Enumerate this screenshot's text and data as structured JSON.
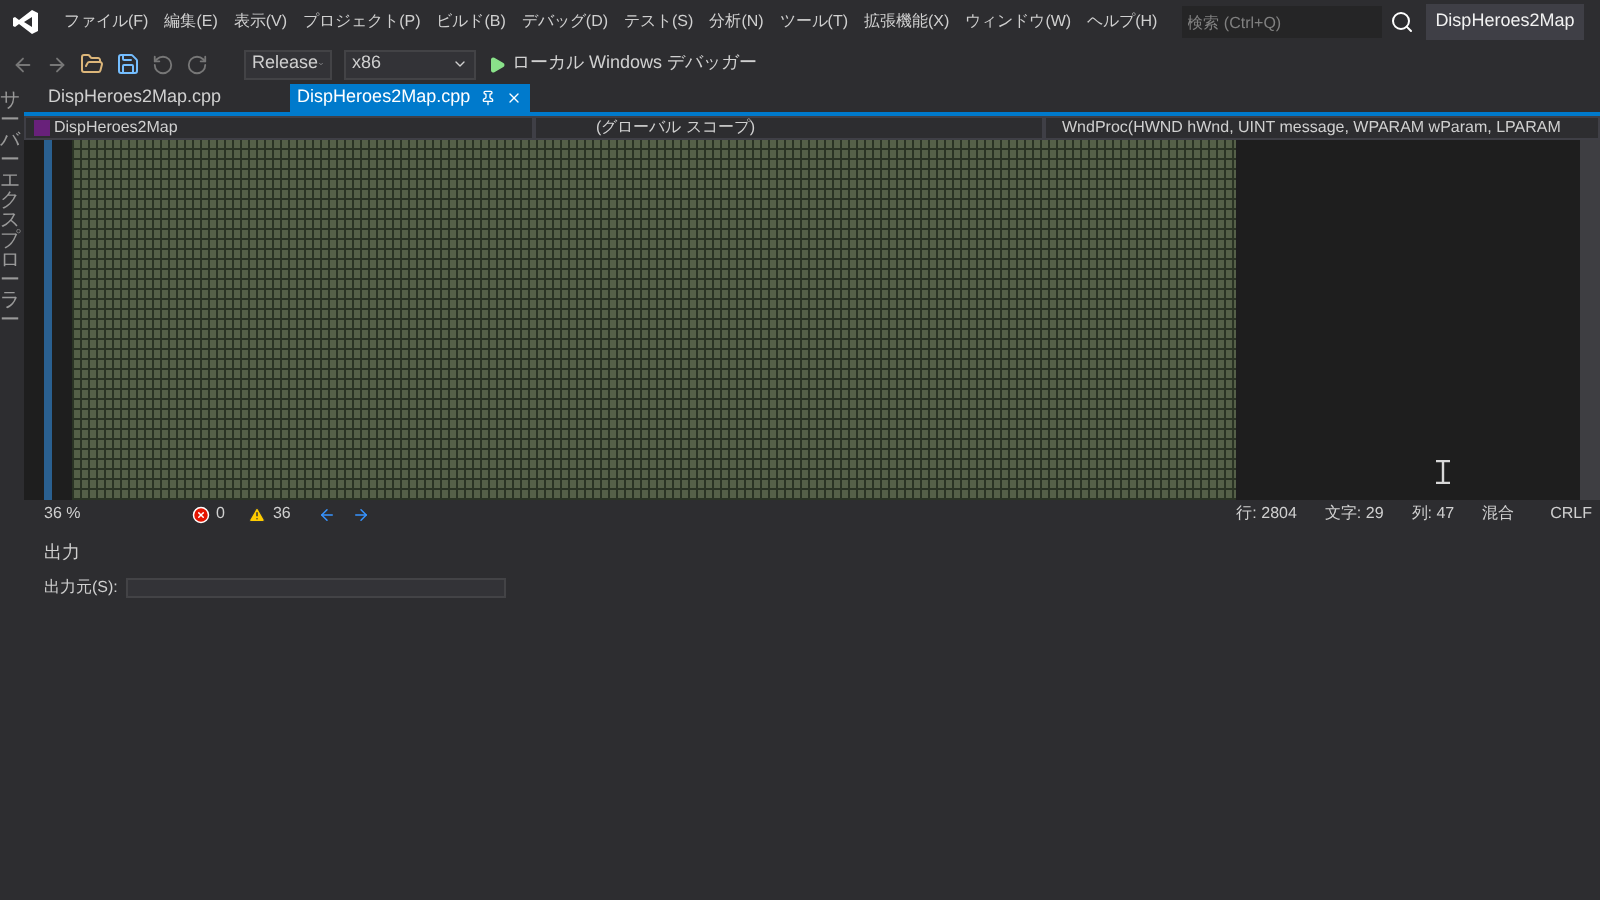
{
  "menu": [
    "ファイル(F)",
    "編集(E)",
    "表示(V)",
    "プロジェクト(P)",
    "ビルド(B)",
    "デバッグ(D)",
    "テスト(S)",
    "分析(N)",
    "ツール(T)",
    "拡張機能(X)",
    "ウィンドウ(W)",
    "ヘルプ(H)"
  ],
  "search": {
    "placeholder": "検索 (Ctrl+Q)"
  },
  "window": {
    "title": "DispHeroes2Map"
  },
  "toolbar": {
    "configuration": "Release",
    "platform": "x86",
    "debugger": "ローカル Windows デバッガー"
  },
  "side_panel": {
    "label": "サーバーエクスプローラー"
  },
  "tabs": [
    {
      "label": "DispHeroes2Map.cpp",
      "selected": false
    },
    {
      "label": "DispHeroes2Map.cpp",
      "selected": true
    }
  ],
  "navigation": {
    "project": "DispHeroes2Map",
    "scope": "(グローバル スコープ)",
    "member": "WndProc(HWND hWnd, UINT message, WPARAM wParam, LPARAM"
  },
  "status_bar": {
    "zoom": "36 %",
    "errors": "0",
    "warnings": "36",
    "line": "行: 2804",
    "char": "文字: 29",
    "column": "列: 47",
    "mode": "混合",
    "line_ending": "CRLF"
  },
  "output": {
    "title": "出力",
    "source_label": "出力元(S):"
  }
}
